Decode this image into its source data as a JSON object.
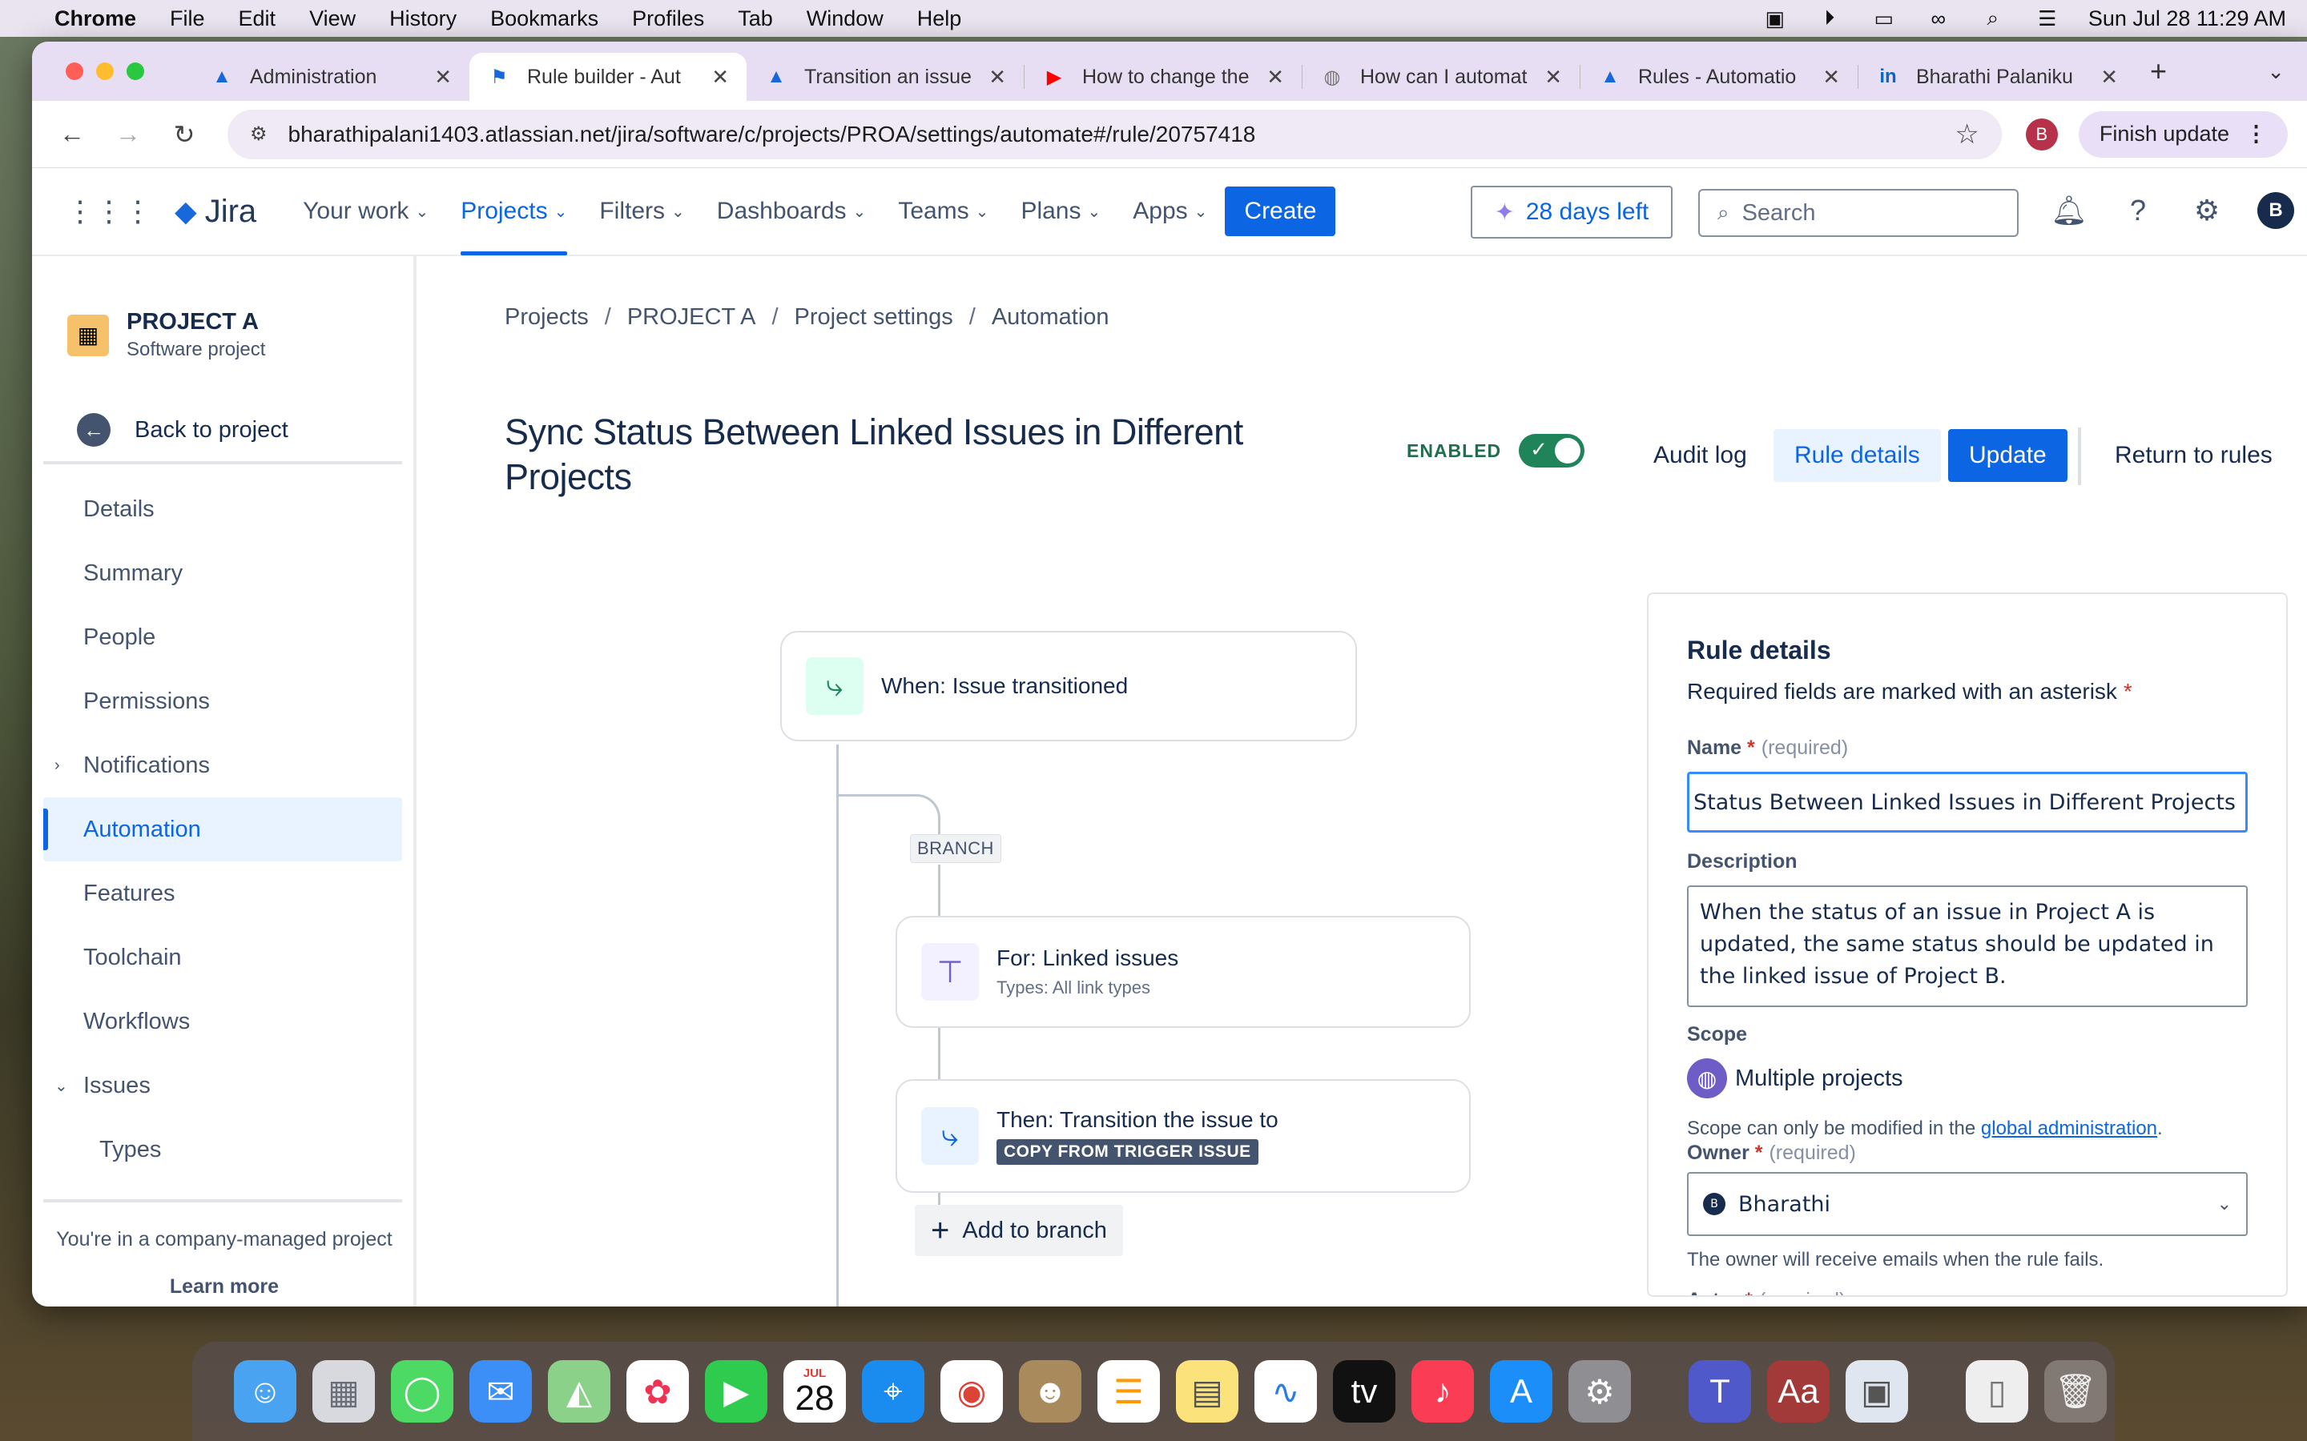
{
  "menubar": {
    "app": "Chrome",
    "items": [
      "File",
      "Edit",
      "View",
      "History",
      "Bookmarks",
      "Profiles",
      "Tab",
      "Window",
      "Help"
    ],
    "datetime": "Sun Jul 28  11:29 AM"
  },
  "browser": {
    "tabs": [
      {
        "title": "Administration",
        "icon": "atlassian-icon"
      },
      {
        "title": "Rule builder - Aut",
        "icon": "jira-icon"
      },
      {
        "title": "Transition an issue",
        "icon": "atlassian-icon"
      },
      {
        "title": "How to change the",
        "icon": "youtube-icon"
      },
      {
        "title": "How can I automat",
        "icon": "globe-icon"
      },
      {
        "title": "Rules - Automatio",
        "icon": "atlassian-icon"
      },
      {
        "title": "Bharathi Palaniku",
        "icon": "linkedin-icon"
      }
    ],
    "url": "bharathipalani1403.atlassian.net/jira/software/c/projects/PROA/settings/automate#/rule/20757418",
    "profile_initial": "B",
    "finish_update": "Finish update"
  },
  "jira_nav": {
    "logo": "Jira",
    "items": [
      "Your work",
      "Projects",
      "Filters",
      "Dashboards",
      "Teams",
      "Plans",
      "Apps"
    ],
    "create": "Create",
    "trial": "28 days left",
    "search_placeholder": "Search",
    "avatar_initial": "B"
  },
  "sidebar": {
    "project_name": "PROJECT A",
    "project_type": "Software project",
    "back": "Back to project",
    "items": [
      "Details",
      "Summary",
      "People",
      "Permissions",
      "Notifications",
      "Automation",
      "Features",
      "Toolchain",
      "Workflows",
      "Issues",
      "Types"
    ],
    "footer_text": "You're in a company-managed project",
    "footer_link": "Learn more"
  },
  "main": {
    "breadcrumb": [
      "Projects",
      "PROJECT A",
      "Project settings",
      "Automation"
    ],
    "title": "Sync Status Between Linked Issues in Different Projects",
    "enabled_label": "ENABLED",
    "audit_log": "Audit log",
    "rule_details_btn": "Rule details",
    "update_btn": "Update",
    "return_btn": "Return to rules"
  },
  "flow": {
    "trigger": "When: Issue transitioned",
    "branch_tag": "BRANCH",
    "branch_title": "For: Linked issues",
    "branch_sub": "Types: All link types",
    "action_title": "Then: Transition the issue to",
    "action_lozenge": "COPY FROM TRIGGER ISSUE",
    "add_to_branch": "Add to branch"
  },
  "panel": {
    "title": "Rule details",
    "required_note": "Required fields are marked with an asterisk",
    "name_label": "Name",
    "required_tag": "(required)",
    "name_value": "c Status Between Linked Issues in Different Projects",
    "description_label": "Description",
    "description_value": "When the status of an issue in Project A is updated, the same status should be updated in the linked issue of Project B.",
    "scope_label": "Scope",
    "scope_value": "Multiple projects",
    "scope_note": "Scope can only be modified in the",
    "scope_link": "global administration",
    "owner_label": "Owner",
    "owner_value": "Bharathi",
    "owner_initial": "B",
    "owner_note": "The owner will receive emails when the rule fails.",
    "actor_label": "Actor"
  },
  "dock": {
    "calendar_month": "JUL",
    "calendar_day": "28"
  }
}
